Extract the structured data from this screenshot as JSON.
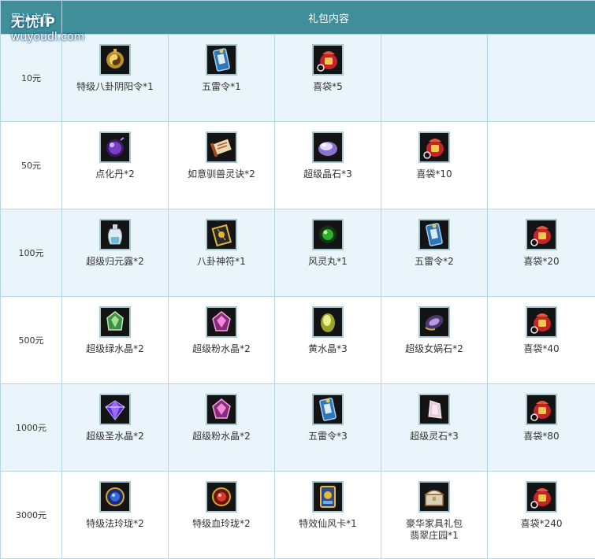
{
  "table": {
    "header": {
      "amount_col": "累计充值",
      "gift_col": "礼包内容"
    },
    "rows": [
      {
        "amount": "10元",
        "items": [
          {
            "name": "特级八卦阴阳令*1",
            "icon": "yinyang-token-icon"
          },
          {
            "name": "五雷令*1",
            "icon": "thunder-token-icon"
          },
          {
            "name": "喜袋*5",
            "icon": "lucky-bag-icon"
          }
        ]
      },
      {
        "amount": "50元",
        "items": [
          {
            "name": "点化丹*2",
            "icon": "purple-pill-icon"
          },
          {
            "name": "如意驯兽灵诀*2",
            "icon": "scroll-icon"
          },
          {
            "name": "超级晶石*3",
            "icon": "crystal-stone-icon"
          },
          {
            "name": "喜袋*10",
            "icon": "lucky-bag-icon"
          }
        ]
      },
      {
        "amount": "100元",
        "items": [
          {
            "name": "超级归元露*2",
            "icon": "potion-bottle-icon"
          },
          {
            "name": "八卦神符*1",
            "icon": "bagua-talisman-icon"
          },
          {
            "name": "风灵丸*1",
            "icon": "green-orb-icon"
          },
          {
            "name": "五雷令*2",
            "icon": "thunder-token-icon"
          },
          {
            "name": "喜袋*20",
            "icon": "lucky-bag-icon"
          }
        ]
      },
      {
        "amount": "500元",
        "items": [
          {
            "name": "超级绿水晶*2",
            "icon": "green-crystal-icon"
          },
          {
            "name": "超级粉水晶*2",
            "icon": "pink-crystal-icon"
          },
          {
            "name": "黄水晶*3",
            "icon": "yellow-crystal-icon"
          },
          {
            "name": "超级女娲石*2",
            "icon": "nuwa-stone-icon"
          },
          {
            "name": "喜袋*40",
            "icon": "lucky-bag-icon"
          }
        ]
      },
      {
        "amount": "1000元",
        "items": [
          {
            "name": "超级圣水晶*2",
            "icon": "diamond-icon"
          },
          {
            "name": "超级粉水晶*2",
            "icon": "pink-crystal-icon"
          },
          {
            "name": "五雷令*3",
            "icon": "thunder-token-icon"
          },
          {
            "name": "超级灵石*3",
            "icon": "spirit-stone-icon"
          },
          {
            "name": "喜袋*80",
            "icon": "lucky-bag-icon"
          }
        ]
      },
      {
        "amount": "3000元",
        "items": [
          {
            "name": "特级法玲珑*2",
            "icon": "blue-ring-icon"
          },
          {
            "name": "特级血玲珑*2",
            "icon": "red-ring-icon"
          },
          {
            "name": "特效仙风卡*1",
            "icon": "card-icon"
          },
          {
            "name": "豪华家具礼包\n翡翠庄园*1",
            "icon": "treasure-chest-icon"
          },
          {
            "name": "喜袋*240",
            "icon": "lucky-bag-icon"
          }
        ]
      }
    ]
  },
  "watermark": {
    "logo": "无忧IP",
    "url": "wuyoudl.com"
  },
  "colors": {
    "header_bg": "#3f8e99",
    "row_odd_bg": "#e9f5fb",
    "row_even_bg": "#ffffff",
    "border": "#b7d6e3",
    "icon_frame": "#a9c9d2"
  }
}
